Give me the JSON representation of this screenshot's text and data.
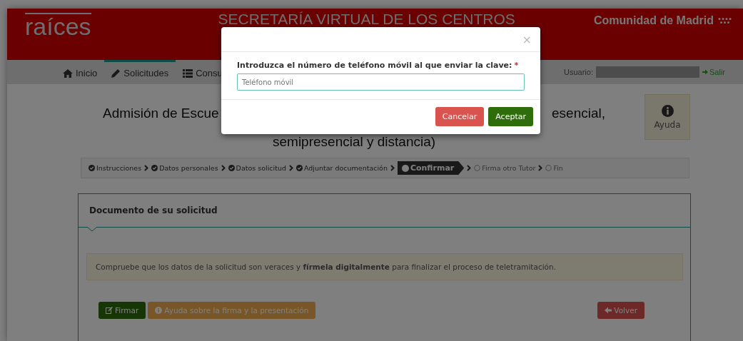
{
  "header": {
    "logo": "raíces",
    "title": "SECRETARÍA VIRTUAL DE LOS CENTROS",
    "region": "Comunidad de Madrid"
  },
  "nav": {
    "items": [
      {
        "label": "Inicio",
        "selected": false
      },
      {
        "label": "Solicitudes",
        "selected": true
      },
      {
        "label": "Consu",
        "selected": false
      }
    ],
    "user_label": "Usuario:",
    "logout": "Salir"
  },
  "page_title": {
    "left": "Admisión de Escue",
    "right": "esencial,",
    "line2": "semipresencial y distancia)"
  },
  "help_button": "Ayuda",
  "steps": [
    {
      "label": "Instrucciones",
      "kind": "done"
    },
    {
      "label": "Datos personales",
      "kind": "done"
    },
    {
      "label": "Datos solicitud",
      "kind": "done"
    },
    {
      "label": "Adjuntar documentación",
      "kind": "done"
    },
    {
      "label": "Confirmar",
      "kind": "current"
    },
    {
      "label": "Firma otro Tutor",
      "kind": "pending"
    },
    {
      "label": "Fin",
      "kind": "pending"
    }
  ],
  "panel": {
    "title": "Documento de su solicitud",
    "alert": "Compruebe que los datos de la solicitud son veraces y **fírmela digitalmente** para finalizar el proceso de teletramitación.",
    "buttons": [
      {
        "label": "Firmar",
        "kind": "sign"
      },
      {
        "label": "Ayuda sobre la firma y la presentación",
        "kind": "help"
      },
      {
        "label": "Volver",
        "kind": "back"
      }
    ]
  },
  "modal": {
    "close": "×",
    "label": "Introduzca el número de teléfono móvil al que enviar la clave:",
    "required_mark": "*",
    "placeholder": "Teléfono móvil",
    "buttons": [
      {
        "label": "Cancelar",
        "kind": "cancel"
      },
      {
        "label": "Aceptar",
        "kind": "accept"
      }
    ]
  }
}
